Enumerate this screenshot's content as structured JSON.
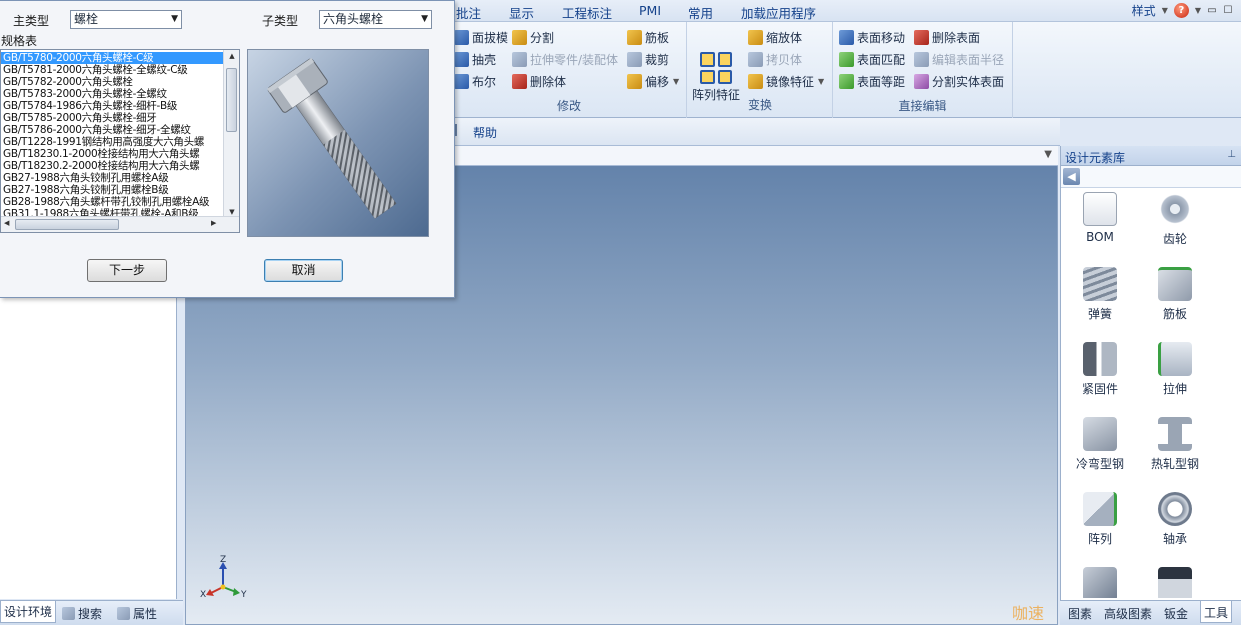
{
  "ribbon": {
    "tabs": [
      "批注",
      "显示",
      "工程标注",
      "PMI",
      "常用",
      "加载应用程序"
    ],
    "style_label": "样式",
    "help_icon": "help-icon",
    "groups": {
      "modify": {
        "label": "修改",
        "buttons": [
          "面拔模",
          "分割",
          "筋板",
          "抽壳",
          "拉伸零件/装配体",
          "裁剪",
          "布尔",
          "删除体",
          "偏移"
        ]
      },
      "transform": {
        "label": "变换",
        "big_button": "阵列特征",
        "buttons": [
          "缩放体",
          "拷贝体",
          "镜像特征"
        ]
      },
      "direct_edit": {
        "label": "直接编辑",
        "buttons": [
          "表面移动",
          "删除表面",
          "表面匹配",
          "编辑表面半径",
          "表面等距",
          "分割实体表面"
        ]
      }
    },
    "strip_help": "帮助"
  },
  "dialog": {
    "main_type_label": "主类型",
    "main_type_value": "螺栓",
    "sub_type_label": "子类型",
    "sub_type_value": "六角头螺栓",
    "spec_table_label": "规格表",
    "spec_items": [
      "GB/T5780-2000六角头螺栓-C级",
      "GB/T5781-2000六角头螺栓-全螺纹-C级",
      "GB/T5782-2000六角头螺栓",
      "GB/T5783-2000六角头螺栓-全螺纹",
      "GB/T5784-1986六角头螺栓-细杆-B级",
      "GB/T5785-2000六角头螺栓-细牙",
      "GB/T5786-2000六角头螺栓-细牙-全螺纹",
      "GB/T1228-1991钢结构用高强度大六角头螺",
      "GB/T18230.1-2000栓接结构用大六角头螺",
      "GB/T18230.2-2000栓接结构用大六角头螺",
      "GB27-1988六角头铰制孔用螺栓A级",
      "GB27-1988六角头铰制孔用螺栓B级",
      "GB28-1988六角头螺杆带孔铰制孔用螺栓A级",
      "GB31.1-1988六角头螺杆带孔螺栓-A和B级"
    ],
    "next_button": "下一步",
    "cancel_button": "取消"
  },
  "left_panel": {
    "tabs": [
      "设计环境",
      "搜索",
      "属性"
    ]
  },
  "viewport": {
    "axis_labels": {
      "z": "Z",
      "x": "X",
      "y": "Y"
    }
  },
  "library": {
    "title": "设计元素库",
    "items": [
      "BOM",
      "齿轮",
      "弹簧",
      "筋板",
      "紧固件",
      "拉伸",
      "冷弯型钢",
      "热轧型钢",
      "阵列",
      "轴承"
    ],
    "tabs": [
      "图素",
      "高级图素",
      "钣金",
      "工具"
    ],
    "watermark": "咖速"
  }
}
